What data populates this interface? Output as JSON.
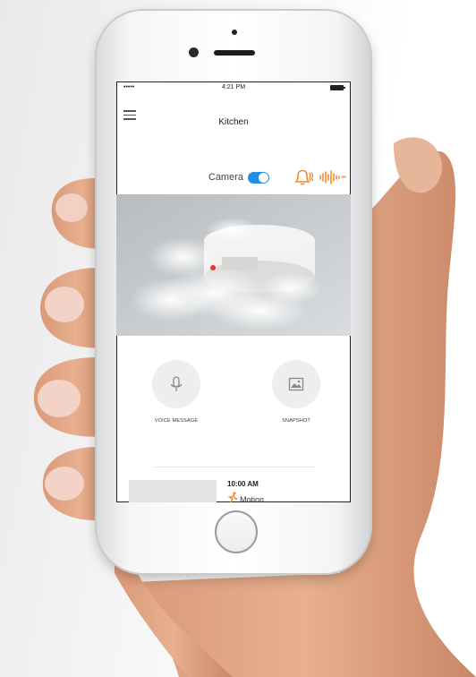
{
  "status_bar": {
    "signal": "•••••",
    "time": "4:21 PM"
  },
  "header": {
    "title": "Kitchen"
  },
  "camera": {
    "label": "Camera",
    "enabled": true
  },
  "icons": {
    "alarm": "alarm-bell-icon",
    "sound": "sound-wave-icon",
    "menu": "hamburger-menu-icon",
    "mic": "microphone-icon",
    "snapshot": "image-icon",
    "motion": "running-person-icon"
  },
  "actions": {
    "voice_label": "VOICE MESSAGE",
    "snapshot_label": "SNAPSHOT"
  },
  "event": {
    "time": "10:00 AM",
    "type": "Motion"
  },
  "colors": {
    "accent": "#f38b2e",
    "toggle": "#1f8fe8"
  }
}
